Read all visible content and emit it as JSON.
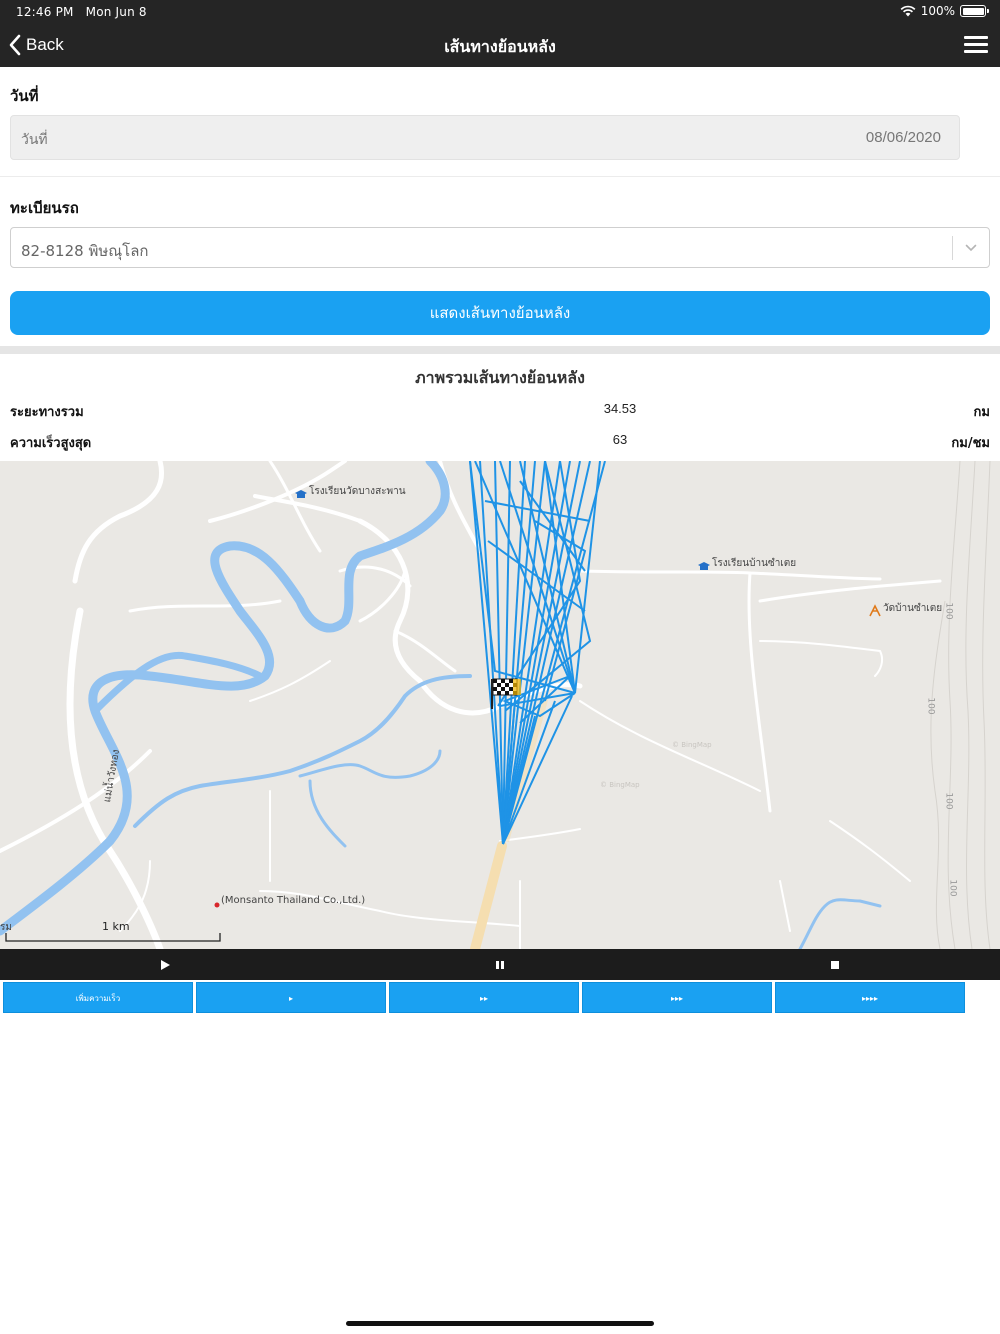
{
  "status_bar": {
    "time": "12:46 PM",
    "date": "Mon Jun 8",
    "battery": "100%"
  },
  "nav": {
    "back_label": "Back",
    "title": "เส้นทางย้อนหลัง",
    "menu_icon": "hamburger-menu-icon"
  },
  "form": {
    "date_label": "วันที่",
    "date_placeholder": "วันที่",
    "date_value": "08/06/2020",
    "plate_label": "ทะเบียนรถ",
    "plate_value": "82-8128 พิษณุโลก",
    "submit_label": "แสดงเส้นทางย้อนหลัง"
  },
  "summary": {
    "title": "ภาพรวมเส้นทางย้อนหลัง",
    "rows": [
      {
        "label": "ระยะทางรวม",
        "value": "34.53",
        "unit": "กม"
      },
      {
        "label": "ความเร็วสูงสุด",
        "value": "63",
        "unit": "กม/ชม"
      }
    ]
  },
  "map": {
    "labels": {
      "school1": "โรงเรียนวัดบางสะพาน",
      "school2": "โรงเรียนบ้านซำเตย",
      "temple": "วัดบ้านซำเตย",
      "company": "(Monsanto Thailand Co.,Ltd.)",
      "river": "แม่น้ำวังทอง",
      "edge": "รม",
      "contour1": "100",
      "contour2": "100",
      "contour3": "100",
      "contour4": "100",
      "wm1": "© BingMap",
      "wm2": "© BingMap"
    },
    "scale": "1 km",
    "colors": {
      "route": "#1f93e6",
      "river": "#92c2f0",
      "road": "#ffffff",
      "land": "#eae8e4"
    }
  },
  "playback": {
    "play_icon": "play-icon",
    "pause_icon": "pause-icon",
    "stop_icon": "stop-icon"
  },
  "speed": {
    "buttons": [
      {
        "label": "เพิ่มความเร็ว"
      },
      {
        "label": "▸"
      },
      {
        "label": "▸▸"
      },
      {
        "label": "▸▸▸"
      },
      {
        "label": "▸▸▸▸"
      }
    ]
  }
}
